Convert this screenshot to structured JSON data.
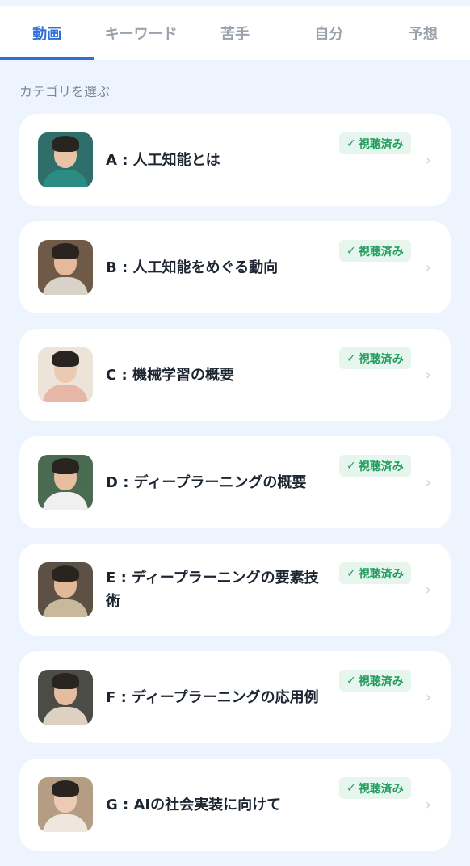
{
  "tabs": [
    {
      "label": "動画",
      "active": true
    },
    {
      "label": "キーワード",
      "active": false
    },
    {
      "label": "苦手",
      "active": false
    },
    {
      "label": "自分",
      "active": false
    },
    {
      "label": "予想",
      "active": false
    }
  ],
  "section_label": "カテゴリを選ぶ",
  "badge_check": "✓",
  "chevron": "›",
  "categories": [
    {
      "title": "A : 人工知能とは",
      "badge": "視聴済み",
      "thumb_bg": "#2f6e6a",
      "thumb_body": "#2b8c83",
      "skin": "#e8c3a6"
    },
    {
      "title": "B : 人工知能をめぐる動向",
      "badge": "視聴済み",
      "thumb_bg": "#6f5a48",
      "thumb_body": "#d8d2c8",
      "skin": "#e6b99a"
    },
    {
      "title": "C : 機械学習の概要",
      "badge": "視聴済み",
      "thumb_bg": "#ece3d9",
      "thumb_body": "#e6b7a6",
      "skin": "#eccab2"
    },
    {
      "title": "D : ディープラーニングの概要",
      "badge": "視聴済み",
      "thumb_bg": "#4a6a52",
      "thumb_body": "#f0f0f0",
      "skin": "#e5bfa0"
    },
    {
      "title": "E : ディープラーニングの要素技術",
      "badge": "視聴済み",
      "thumb_bg": "#5d5146",
      "thumb_body": "#c8b89c",
      "skin": "#e2b897"
    },
    {
      "title": "F : ディープラーニングの応用例",
      "badge": "視聴済み",
      "thumb_bg": "#4b4c46",
      "thumb_body": "#ddd2c2",
      "skin": "#e4bd9e"
    },
    {
      "title": "G : AIの社会実装に向けて",
      "badge": "視聴済み",
      "thumb_bg": "#b59d84",
      "thumb_body": "#efe7dd",
      "skin": "#edcbb2"
    }
  ]
}
